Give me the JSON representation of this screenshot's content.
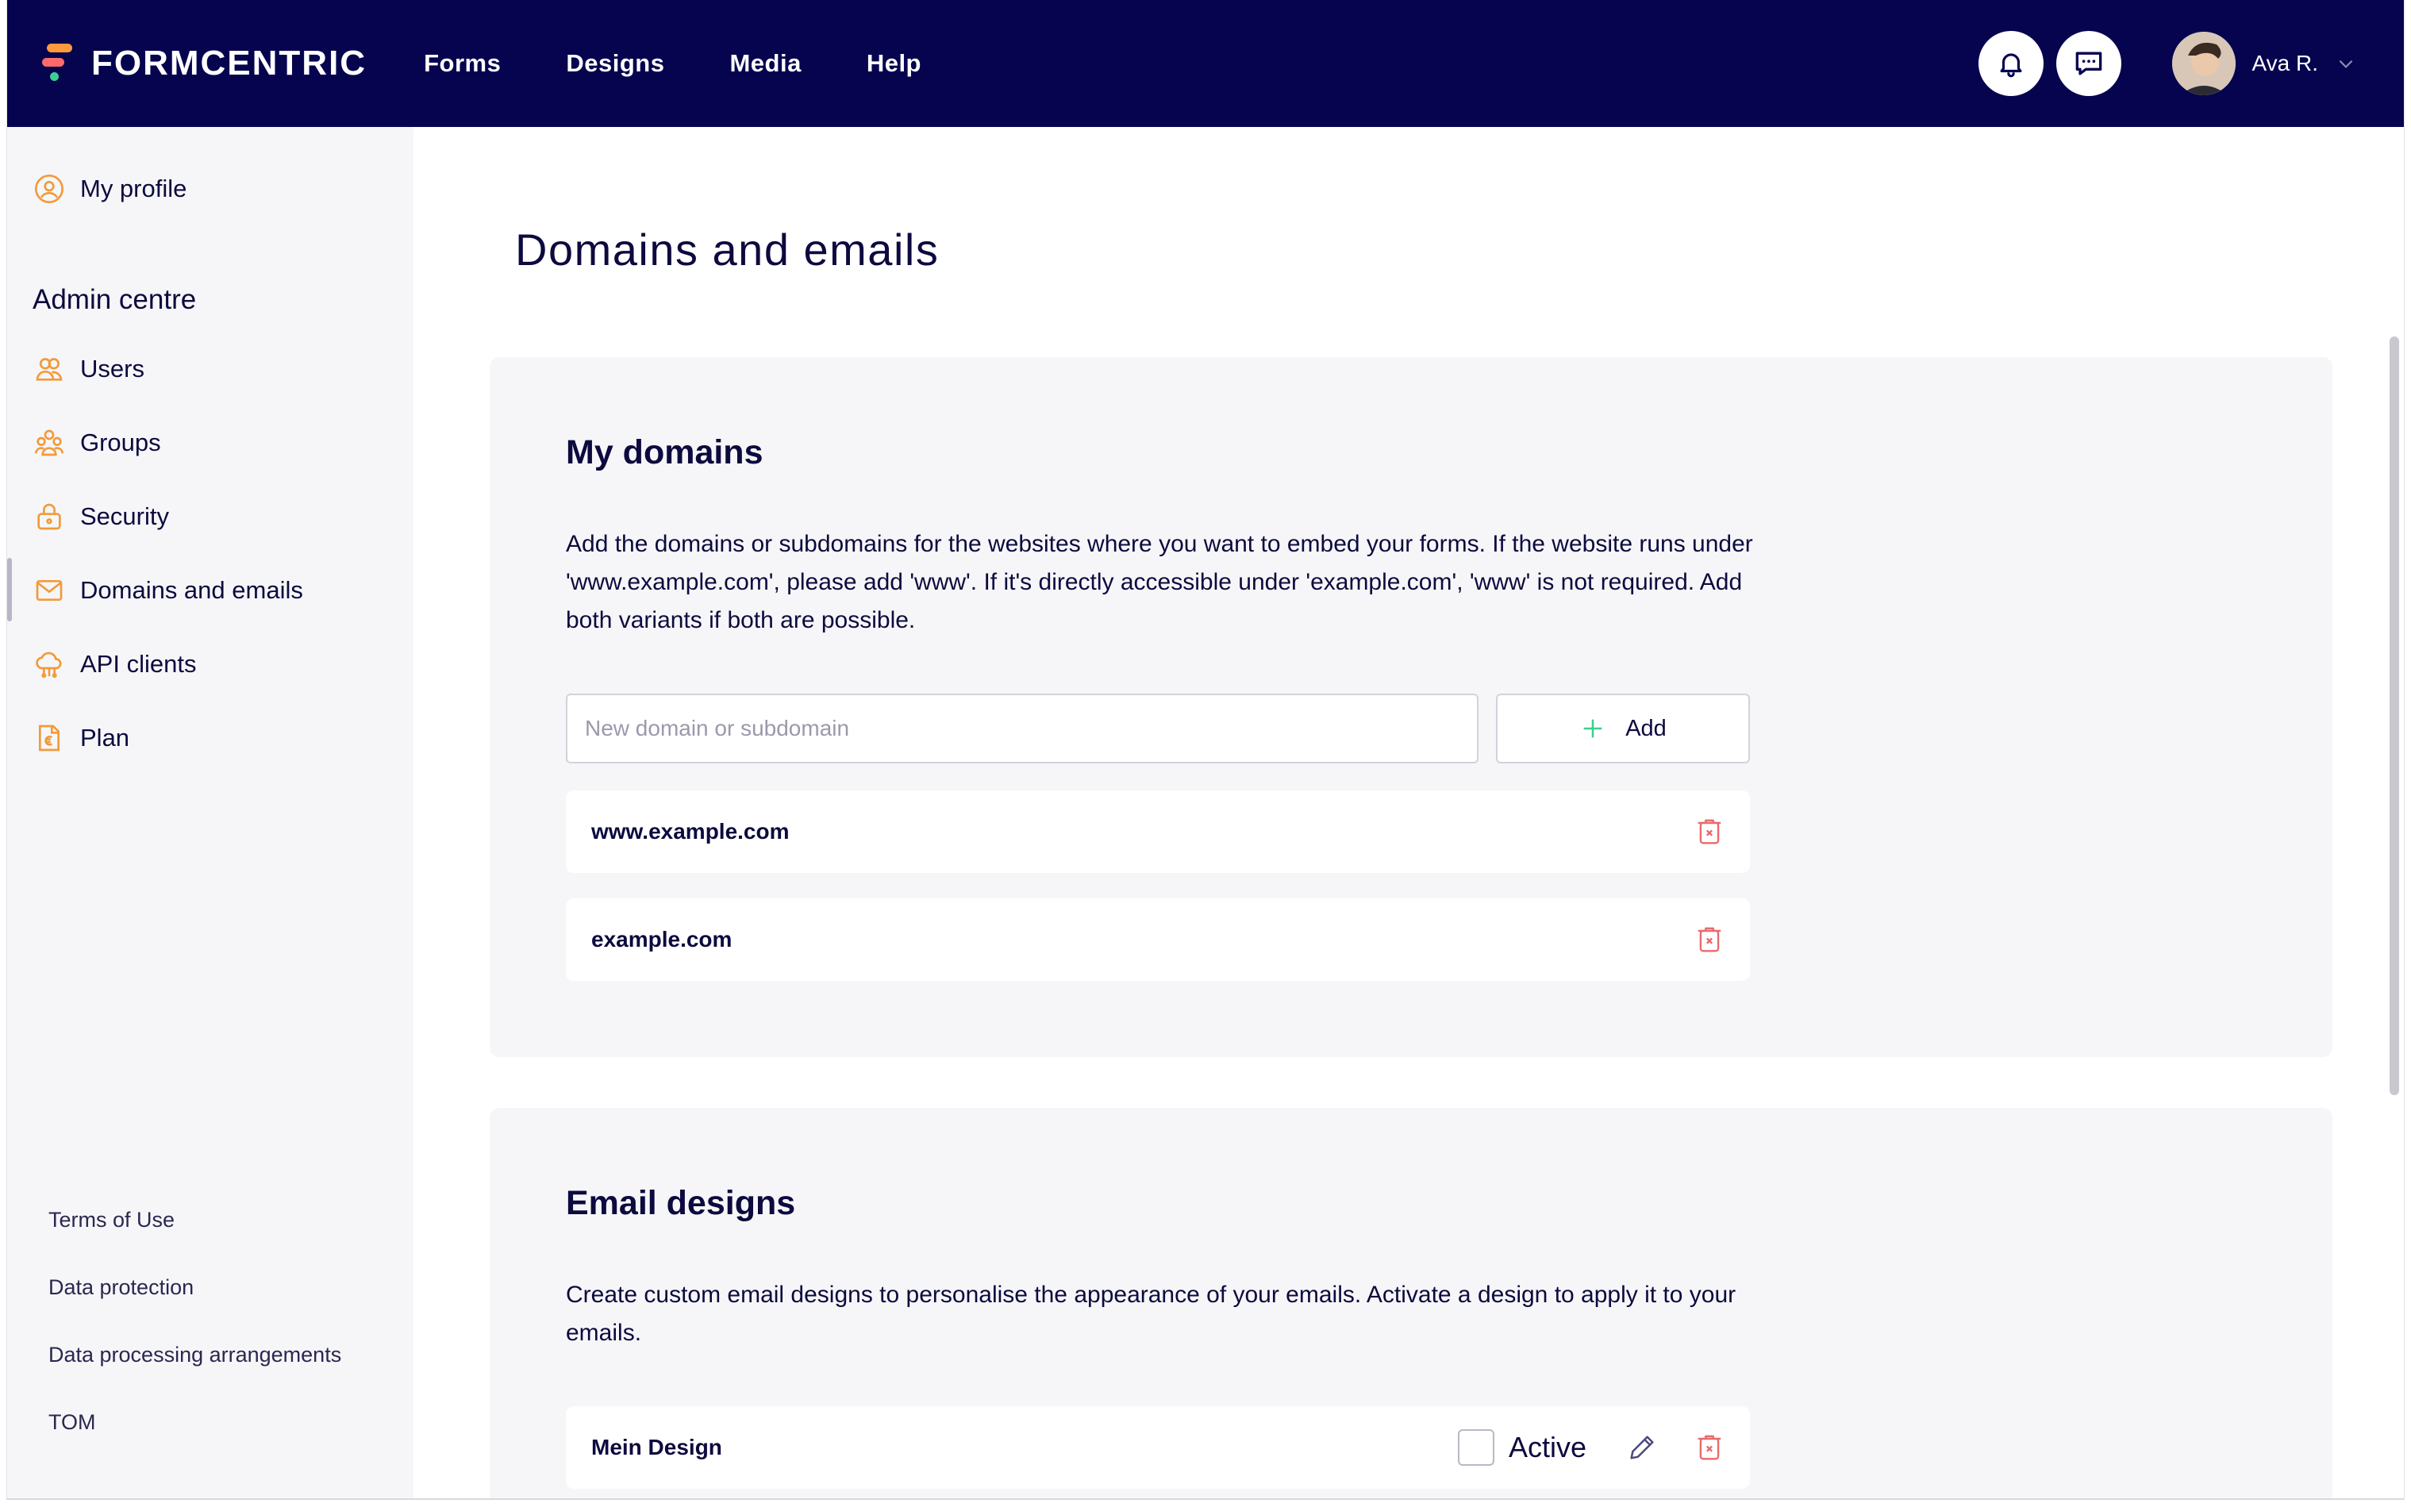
{
  "app": {
    "brand": "FORMCENTRIC",
    "nav": [
      "Forms",
      "Designs",
      "Media",
      "Help"
    ],
    "user_name": "Ava R."
  },
  "sidebar": {
    "profile": "My profile",
    "heading": "Admin centre",
    "items": [
      {
        "label": "Users",
        "icon": "users-icon"
      },
      {
        "label": "Groups",
        "icon": "groups-icon"
      },
      {
        "label": "Security",
        "icon": "lock-icon"
      },
      {
        "label": "Domains and emails",
        "icon": "mail-icon",
        "active": true
      },
      {
        "label": "API clients",
        "icon": "api-icon"
      },
      {
        "label": "Plan",
        "icon": "euro-document-icon"
      }
    ],
    "footer": [
      "Terms of Use",
      "Data protection",
      "Data processing arrangements",
      "TOM"
    ]
  },
  "main": {
    "title": "Domains and emails",
    "domains": {
      "title": "My domains",
      "description": "Add the domains or subdomains for the websites where you want to embed your forms. If the website runs under 'www.example.com', please add 'www'. If it's directly accessible under 'example.com', 'www' is not required. Add both variants if both are possible.",
      "input_placeholder": "New domain or subdomain",
      "add_label": "Add",
      "list": [
        "www.example.com",
        "example.com"
      ]
    },
    "emails": {
      "title": "Email designs",
      "description": "Create custom email designs to personalise the appearance of your emails. Activate a design to apply it to your emails.",
      "designs": [
        {
          "name": "Mein Design",
          "active_label": "Active",
          "active": false
        }
      ]
    }
  },
  "colors": {
    "nav_bg": "#06044f",
    "accent_orange": "#f29a3a",
    "danger": "#e86a6a",
    "add_green": "#3ccf91"
  }
}
